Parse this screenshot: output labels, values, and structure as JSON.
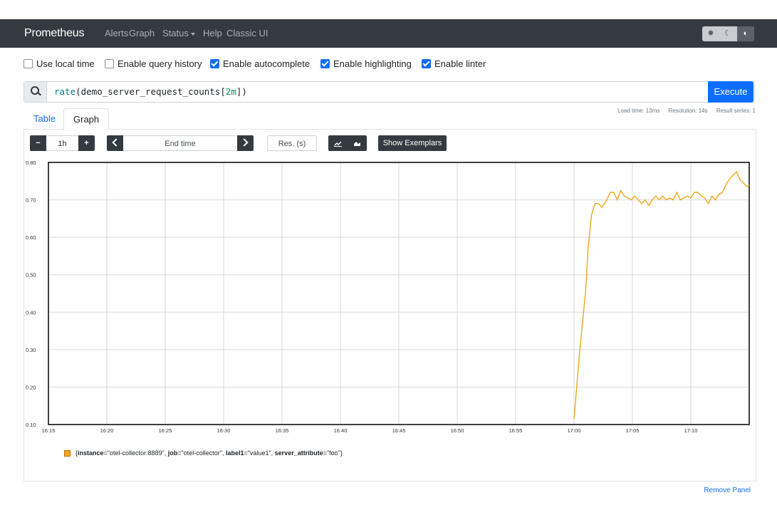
{
  "navbar": {
    "brand": "Prometheus",
    "items": [
      "Alerts",
      "Graph",
      "Status",
      "Help",
      "Classic UI"
    ],
    "theme_icons": [
      "sun-icon",
      "moon-icon",
      "contrast-icon"
    ]
  },
  "options": {
    "use_local_time": {
      "label": "Use local time",
      "checked": false
    },
    "enable_query_history": {
      "label": "Enable query history",
      "checked": false
    },
    "enable_autocomplete": {
      "label": "Enable autocomplete",
      "checked": true
    },
    "enable_highlighting": {
      "label": "Enable highlighting",
      "checked": true
    },
    "enable_linter": {
      "label": "Enable linter",
      "checked": true
    }
  },
  "query": {
    "fn": "rate",
    "metric": "demo_server_request_counts",
    "range": "2m",
    "execute_label": "Execute"
  },
  "tabs": {
    "table": "Table",
    "graph": "Graph"
  },
  "stats": {
    "load_time": "Load time: 13ms",
    "resolution": "Resolution: 14s",
    "result_series": "Result series: 1"
  },
  "controls": {
    "range_value": "1h",
    "end_time_placeholder": "End time",
    "resolution_placeholder": "Res. (s)",
    "show_exemplars": "Show Exemplars"
  },
  "legend_label_parts": {
    "k1": "instance",
    "v1": "\"otel-collector:8889\"",
    "k2": "job",
    "v2": "\"otel-collector\"",
    "k3": "label1",
    "v3": "\"value1\"",
    "k4": "server_attribute",
    "v4": "\"foo\""
  },
  "remove_panel": "Remove Panel",
  "chart_data": {
    "type": "line",
    "title": "",
    "xlabel": "",
    "ylabel": "",
    "ylim": [
      0.1,
      0.8
    ],
    "yticks": [
      0.1,
      0.2,
      0.3,
      0.4,
      0.5,
      0.6,
      0.7,
      0.8
    ],
    "yticklabels": [
      "0.10",
      "0.20",
      "0.30",
      "0.40",
      "0.50",
      "0.60",
      "0.70",
      "0.80"
    ],
    "xticklabels": [
      "16:15",
      "16:20",
      "16:25",
      "16:30",
      "16:35",
      "16:40",
      "16:45",
      "16:50",
      "16:55",
      "17:00",
      "17:05",
      "17:10"
    ],
    "grid": true,
    "series": [
      {
        "color": "#f0a81d",
        "x_minutes_from_1615": [
          45.0,
          45.5,
          46.0,
          46.2,
          46.5,
          46.8,
          47.1,
          47.4,
          47.8,
          48.1,
          48.4,
          48.7,
          49.0,
          49.3,
          49.6,
          49.9,
          50.2,
          50.5,
          50.8,
          51.1,
          51.4,
          51.7,
          52.0,
          52.3,
          52.6,
          52.9,
          53.2,
          53.5,
          53.8,
          54.1,
          54.4,
          54.7,
          55.0,
          55.3,
          55.6,
          55.9,
          56.2,
          56.5,
          56.8,
          57.1,
          57.4,
          57.7,
          58.0,
          58.3,
          58.6,
          58.9,
          59.2,
          59.5,
          59.8,
          60.0
        ],
        "values": [
          0.115,
          0.3,
          0.46,
          0.57,
          0.66,
          0.69,
          0.69,
          0.68,
          0.7,
          0.72,
          0.72,
          0.7,
          0.725,
          0.71,
          0.705,
          0.7,
          0.71,
          0.7,
          0.69,
          0.7,
          0.685,
          0.7,
          0.71,
          0.7,
          0.71,
          0.7,
          0.705,
          0.7,
          0.72,
          0.7,
          0.705,
          0.71,
          0.705,
          0.72,
          0.72,
          0.71,
          0.705,
          0.69,
          0.71,
          0.7,
          0.715,
          0.72,
          0.74,
          0.755,
          0.765,
          0.775,
          0.755,
          0.745,
          0.735,
          0.74
        ]
      }
    ]
  }
}
